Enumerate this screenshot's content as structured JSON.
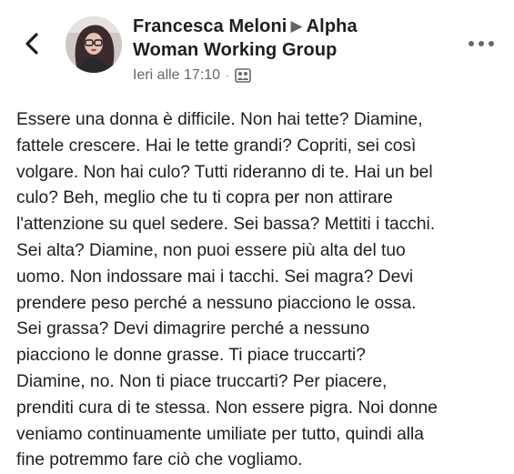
{
  "header": {
    "back_icon": "chevron-left-icon",
    "avatar_icon": "avatar",
    "author": "Francesca Meloni",
    "separator_icon": "triangle-right-icon",
    "group": "Alpha Woman Working Group",
    "group_line1": "Alpha",
    "group_line2": "Woman Working Group",
    "timestamp": "Ieri alle 17:10",
    "dot": "·",
    "audience_icon": "group-members-icon",
    "more_icon": "more-horizontal-icon"
  },
  "post": {
    "lines": [
      "Essere una donna è difficile. Non hai tette? Diamine,",
      "fattele crescere. Hai le tette grandi? Copriti, sei così",
      "volgare. Non hai culo? Tutti rideranno di te. Hai un bel",
      "culo? Beh, meglio che tu ti copra per non attirare",
      "l'attenzione su quel sedere. Sei bassa? Mettiti i tacchi.",
      "Sei alta? Diamine, non puoi essere più alta del tuo",
      "uomo. Non indossare mai i tacchi. Sei magra? Devi",
      "prendere peso perché a nessuno piacciono le ossa.",
      "Sei grassa? Devi dimagrire perché a nessuno",
      "piacciono le donne grasse. Ti piace truccarti?",
      "Diamine, no. Non ti piace truccarti? Per piacere,",
      "prenditi cura di te stessa. Non essere pigra. Noi donne",
      "veniamo continuamente umiliate per tutto, quindi alla",
      "fine potremmo fare ciò che vogliamo."
    ]
  },
  "colors": {
    "text": "#1c1e21",
    "secondary": "#65676b"
  }
}
